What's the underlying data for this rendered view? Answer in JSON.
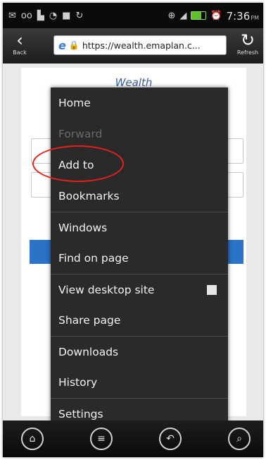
{
  "status_bar": {
    "time": "7:36",
    "ampm": "PM",
    "icons": [
      "mail-icon",
      "voicemail-icon",
      "app-icon",
      "wifi-icon",
      "facebook-icon",
      "sync-icon",
      "gps-icon",
      "signal-icon",
      "battery-icon",
      "alarm-icon"
    ]
  },
  "toolbar": {
    "back_label": "Back",
    "refresh_label": "Refresh",
    "url": "https://wealth.emaplan.c..."
  },
  "page": {
    "title": "Wealth"
  },
  "menu": {
    "items": [
      {
        "label": "Home",
        "enabled": true
      },
      {
        "label": "Forward",
        "enabled": false
      },
      {
        "label": "Add to",
        "enabled": true
      },
      {
        "label": "Bookmarks",
        "enabled": true
      },
      {
        "label": "Windows",
        "enabled": true
      },
      {
        "label": "Find on page",
        "enabled": true
      },
      {
        "label": "View desktop site",
        "enabled": true,
        "checkbox": false
      },
      {
        "label": "Share page",
        "enabled": true
      },
      {
        "label": "Downloads",
        "enabled": true
      },
      {
        "label": "History",
        "enabled": true
      },
      {
        "label": "Settings",
        "enabled": true
      }
    ]
  },
  "highlight": {
    "target": "Add to",
    "color": "#e4201c"
  },
  "nav": {
    "buttons": [
      "home-icon",
      "menu-icon",
      "back-icon",
      "search-icon"
    ]
  },
  "colors": {
    "accent_button": "#2b73c7",
    "menu_bg": "#2a2a2a"
  }
}
